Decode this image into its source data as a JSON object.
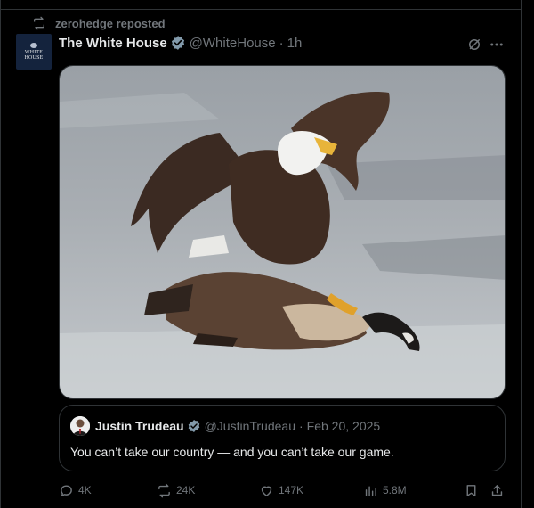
{
  "repost": {
    "text": "zerohedge reposted",
    "icon": "repost-icon"
  },
  "post": {
    "author_name": "The White House",
    "avatar_text_1": "WHITE",
    "avatar_text_2": "HOUSE",
    "handle": "@WhiteHouse",
    "separator": "·",
    "time": "1h",
    "verified_color": "#829aab",
    "image_description_icon": "eagle-attacking-goose-photo"
  },
  "quote": {
    "author_name": "Justin Trudeau",
    "handle": "@JustinTrudeau",
    "separator": "·",
    "date": "Feb 20, 2025",
    "text": "You can’t take our country — and you can’t take our game.",
    "verified_color": "#829aab"
  },
  "actions": {
    "replies": "4K",
    "reposts": "24K",
    "likes": "147K",
    "views": "5.8M"
  },
  "colors": {
    "background": "#000000",
    "text": "#e7e9ea",
    "muted": "#71767b",
    "border": "#2f3336"
  }
}
